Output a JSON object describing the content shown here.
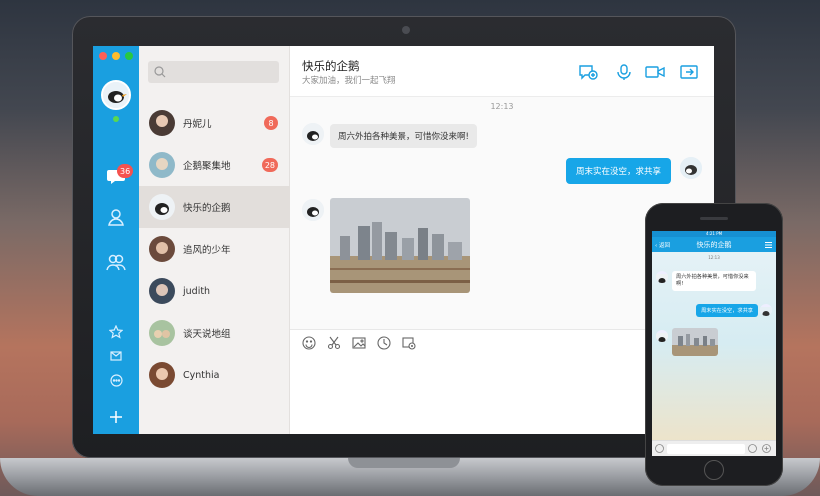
{
  "window": {
    "traffic_colors": [
      "#fe5f57",
      "#febc2e",
      "#28c840"
    ]
  },
  "rail": {
    "message_badge": "36",
    "accent": "#1a9fe0"
  },
  "contacts": [
    {
      "name": "丹妮儿",
      "badge": "8"
    },
    {
      "name": "企鹅聚集地",
      "badge": "28"
    },
    {
      "name": "快乐的企鹅",
      "badge": ""
    },
    {
      "name": "追风的少年",
      "badge": ""
    },
    {
      "name": "judith",
      "badge": ""
    },
    {
      "name": "谈天说地组",
      "badge": ""
    },
    {
      "name": "Cynthia",
      "badge": ""
    }
  ],
  "chat": {
    "title": "快乐的企鹅",
    "subtitle": "大家加油，我们一起飞翔",
    "time": "12:13",
    "messages": [
      {
        "side": "left",
        "text": "周六外拍各种美景，可惜你没来啊!"
      },
      {
        "side": "right",
        "text": "周末实在没空，求共享"
      },
      {
        "side": "left",
        "type": "image"
      }
    ]
  },
  "phone": {
    "status": "4:21 PM",
    "back": "返回",
    "title": "快乐的企鹅",
    "time": "12:13",
    "msg1": "周六外拍各种美景，可惜你没来啊!",
    "msg2": "周末实在没空，求共享"
  }
}
